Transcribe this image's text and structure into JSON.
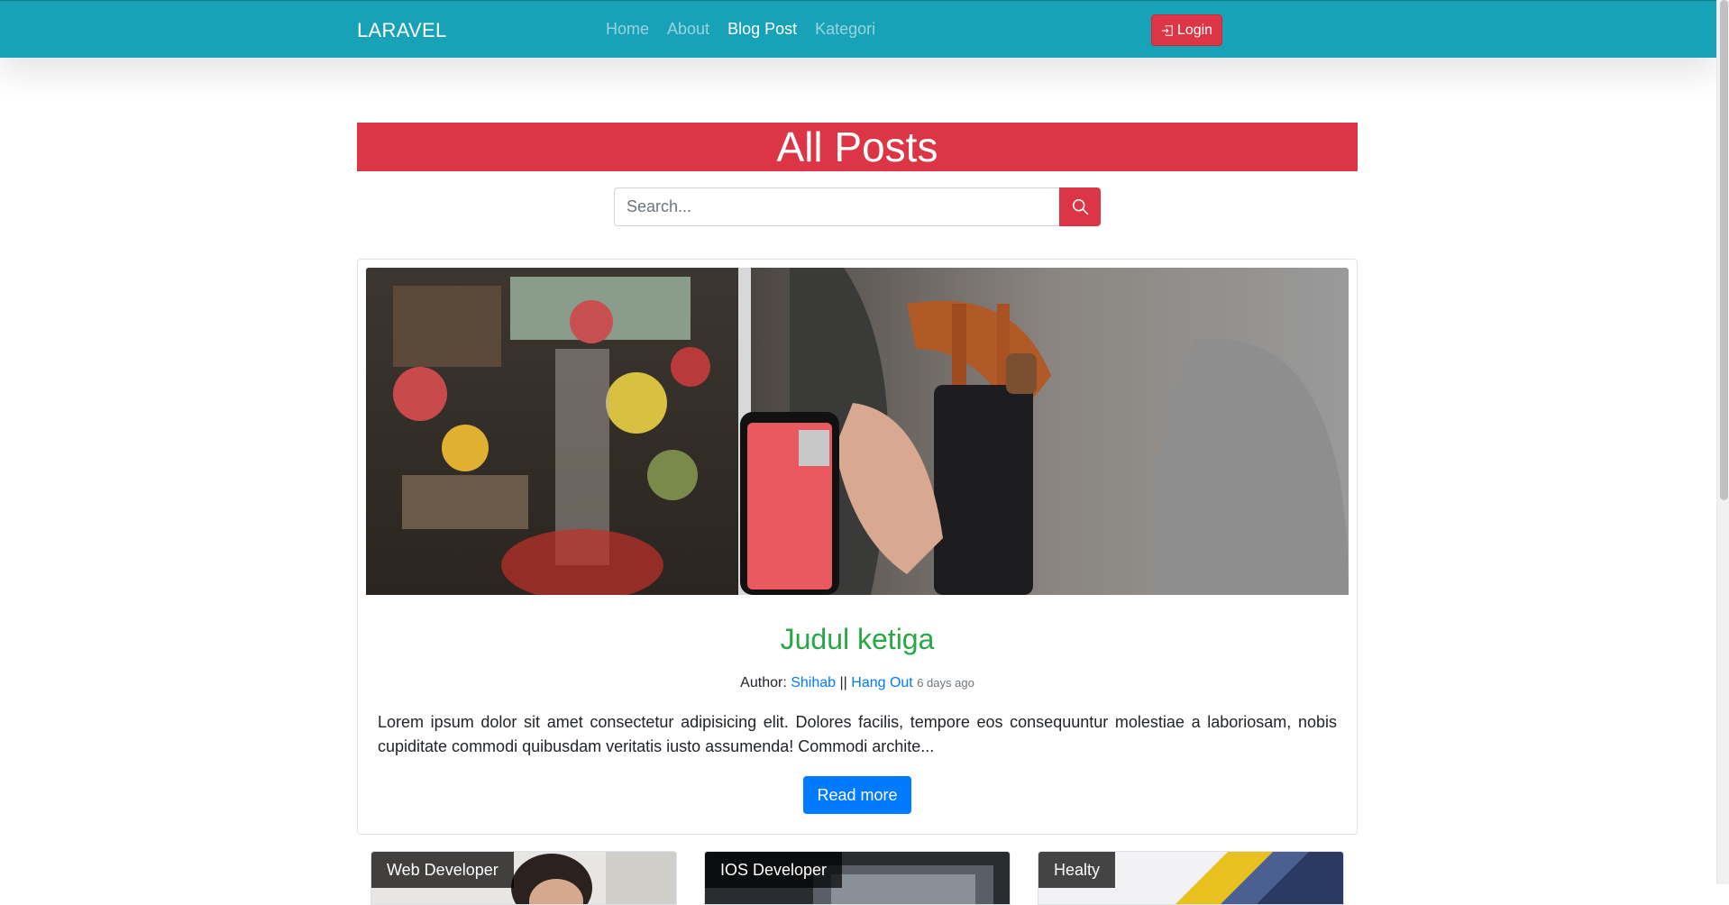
{
  "navbar": {
    "brand": "LARAVEL",
    "links": [
      {
        "label": "Home",
        "active": false
      },
      {
        "label": "About",
        "active": false
      },
      {
        "label": "Blog Post",
        "active": true
      },
      {
        "label": "Kategori",
        "active": false
      }
    ],
    "login_label": "Login",
    "login_icon": "box-arrow-in-right-icon"
  },
  "banner": {
    "title": "All Posts"
  },
  "search": {
    "placeholder": "Search...",
    "value": "",
    "button_icon": "search-icon"
  },
  "featured": {
    "title": "Judul ketiga",
    "author_prefix": "Author:",
    "author": "Shihab",
    "separator": "||",
    "category": "Hang Out",
    "time": "6 days ago",
    "excerpt": "Lorem ipsum dolor sit amet consectetur adipisicing elit. Dolores facilis, tempore eos consequuntur molestiae a laboriosam, nobis cupiditate commodi quibusdam veritatis iusto assumenda! Commodi archite...",
    "read_more": "Read more"
  },
  "cards": [
    {
      "category": "Web Developer"
    },
    {
      "category": "IOS Developer"
    },
    {
      "category": "Healty"
    }
  ],
  "colors": {
    "navbar": "#17a2b8",
    "danger": "#dc3545",
    "primary": "#007bff",
    "success": "#28a745"
  }
}
